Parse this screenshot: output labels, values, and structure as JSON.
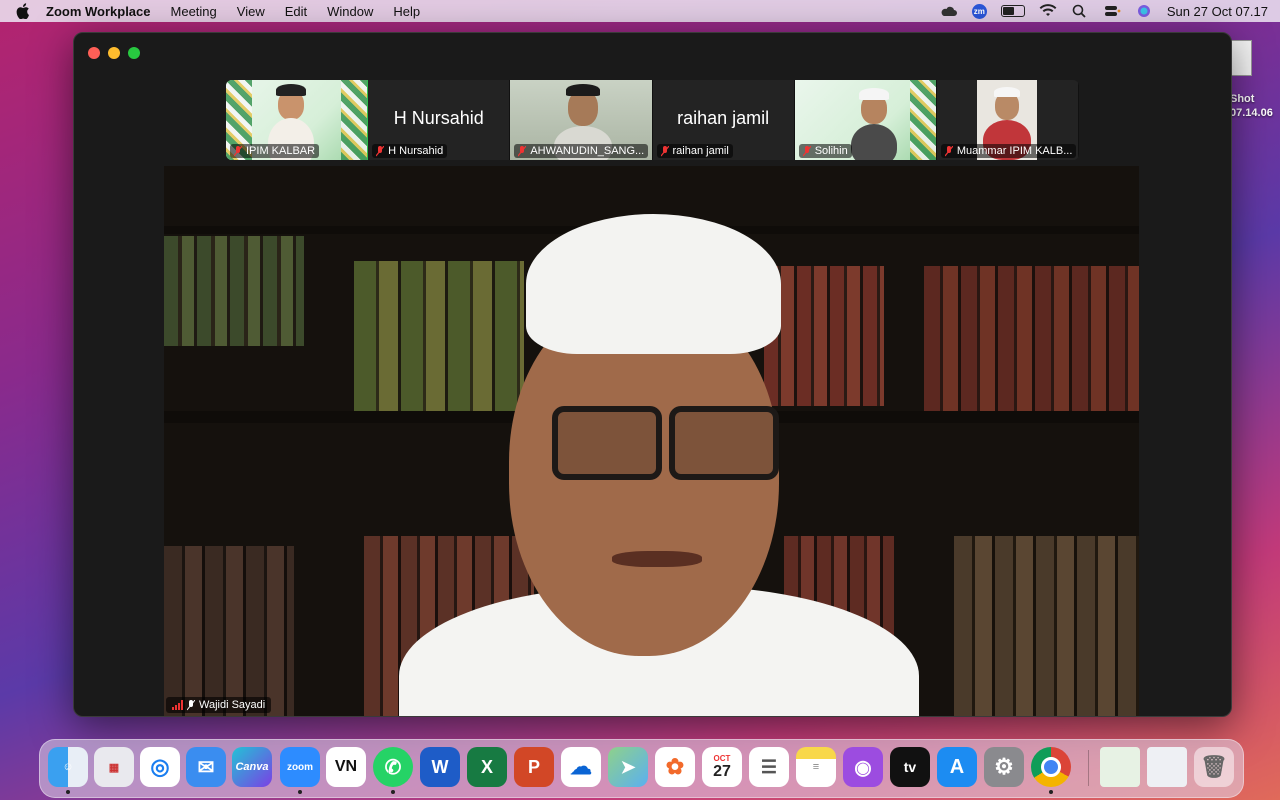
{
  "menubar": {
    "app_name": "Zoom Workplace",
    "menus": [
      "Meeting",
      "View",
      "Edit",
      "Window",
      "Help"
    ],
    "clock": "Sun 27 Oct  07.17",
    "zoom_badge": "zm"
  },
  "desktop": {
    "file_label_line1": "Shot",
    "file_label_line2": "07.14.06"
  },
  "participants": [
    {
      "name": "IPIM KALBAR",
      "muted": true,
      "video": "poster",
      "active": true
    },
    {
      "name": "H Nursahid",
      "muted": true,
      "video": "off",
      "display_name": "H Nursahid"
    },
    {
      "name": "AHWANUDIN_SANG...",
      "muted": true,
      "video": "camera"
    },
    {
      "name": "raihan jamil",
      "muted": true,
      "video": "off",
      "display_name": "raihan jamil"
    },
    {
      "name": "Solihin",
      "muted": true,
      "video": "poster"
    },
    {
      "name": "Muammar IPIM KALB...",
      "muted": true,
      "video": "camera"
    }
  ],
  "main_speaker": {
    "name": "Wajidi Sayadi"
  },
  "dock": {
    "items": [
      {
        "name": "finder",
        "label": "",
        "running": true
      },
      {
        "name": "launchpad",
        "label": "",
        "running": false
      },
      {
        "name": "safari",
        "label": "",
        "running": false
      },
      {
        "name": "mail",
        "label": "",
        "running": false
      },
      {
        "name": "canva",
        "label": "Canva",
        "running": false
      },
      {
        "name": "zoom",
        "label": "zoom",
        "running": true
      },
      {
        "name": "vn",
        "label": "VN",
        "running": false
      },
      {
        "name": "whatsapp",
        "label": "",
        "running": true
      },
      {
        "name": "word",
        "label": "W",
        "running": false
      },
      {
        "name": "excel",
        "label": "X",
        "running": false
      },
      {
        "name": "powerpoint",
        "label": "P",
        "running": false
      },
      {
        "name": "onedrive",
        "label": "",
        "running": false
      },
      {
        "name": "maps",
        "label": "",
        "running": false
      },
      {
        "name": "photos",
        "label": "",
        "running": false
      },
      {
        "name": "calendar",
        "label": "27",
        "month": "OCT",
        "running": false
      },
      {
        "name": "reminders",
        "label": "",
        "running": false
      },
      {
        "name": "notes",
        "label": "",
        "running": false
      },
      {
        "name": "podcasts",
        "label": "",
        "running": false
      },
      {
        "name": "apple-tv",
        "label": "tv",
        "running": false
      },
      {
        "name": "app-store",
        "label": "",
        "running": false
      },
      {
        "name": "system-settings",
        "label": "",
        "running": false
      },
      {
        "name": "chrome",
        "label": "",
        "running": true
      },
      {
        "name": "recent-doc-1",
        "label": "",
        "running": false
      },
      {
        "name": "recent-doc-2",
        "label": "",
        "running": false
      },
      {
        "name": "trash",
        "label": "",
        "running": false
      }
    ]
  }
}
